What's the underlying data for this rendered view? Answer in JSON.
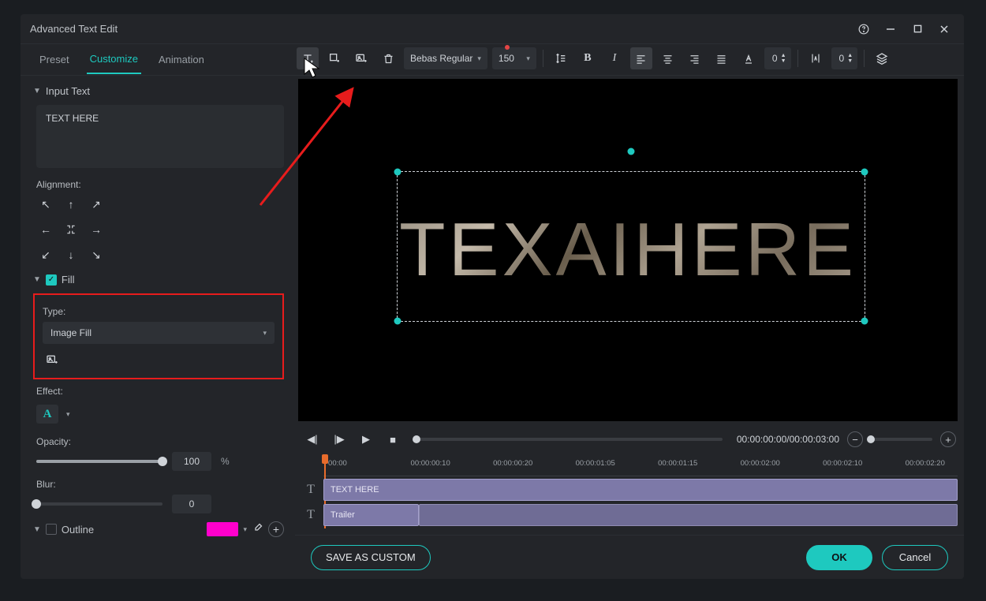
{
  "window": {
    "title": "Advanced Text Edit"
  },
  "tabs": {
    "preset": "Preset",
    "customize": "Customize",
    "animation": "Animation",
    "active": "customize"
  },
  "toolbar": {
    "font": "Bebas Regular",
    "size": "150",
    "spacing1_value": "0",
    "spacing2_value": "0"
  },
  "panel": {
    "input_text": {
      "header": "Input Text",
      "value": "TEXT HERE",
      "alignment_label": "Alignment:"
    },
    "fill": {
      "header": "Fill",
      "checked": true,
      "type_label": "Type:",
      "type_value": "Image Fill"
    },
    "effect_label": "Effect:",
    "opacity": {
      "label": "Opacity:",
      "value": "100",
      "unit": "%"
    },
    "blur": {
      "label": "Blur:",
      "value": "0"
    },
    "outline": {
      "label": "Outline",
      "checked": false,
      "color": "#ff00cc"
    }
  },
  "preview": {
    "text": "TEXAIHERE"
  },
  "playback": {
    "timecode": "00:00:00:00/00:00:03:00"
  },
  "ruler": {
    "ticks": [
      "00:00",
      "00:00:00:10",
      "00:00:00:20",
      "00:00:01:05",
      "00:00:01:15",
      "00:00:02:00",
      "00:00:02:10",
      "00:00:02:20"
    ]
  },
  "tracks": [
    {
      "icon": "T",
      "label": "TEXT HERE",
      "width_pct": 100
    },
    {
      "icon": "T",
      "label": "Trailer",
      "width_pct": 15
    }
  ],
  "footer": {
    "save_custom": "SAVE AS CUSTOM",
    "ok": "OK",
    "cancel": "Cancel"
  }
}
